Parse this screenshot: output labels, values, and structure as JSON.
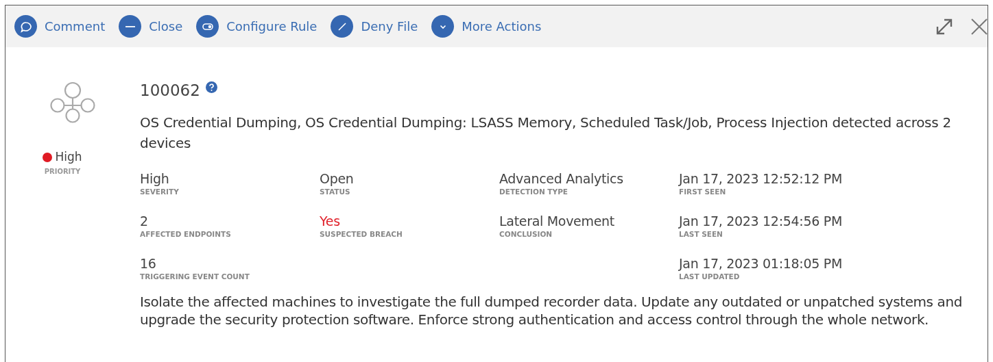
{
  "toolbar": {
    "actions": [
      {
        "label": "Comment",
        "kind": "comment"
      },
      {
        "label": "Close",
        "kind": "close"
      },
      {
        "label": "Configure Rule",
        "kind": "configure"
      },
      {
        "label": "Deny File",
        "kind": "deny"
      },
      {
        "label": "More Actions",
        "kind": "more"
      }
    ]
  },
  "incident": {
    "id": "100062",
    "priority": {
      "value": "High",
      "label": "PRIORITY",
      "color": "#e01b24"
    },
    "description": "OS Credential Dumping, OS Credential Dumping: LSASS Memory, Scheduled Task/Job, Process Injection detected across 2 devices",
    "columns": [
      [
        {
          "value": "High",
          "label": "SEVERITY",
          "alert": false
        },
        {
          "value": "2",
          "label": "AFFECTED ENDPOINTS",
          "alert": false
        },
        {
          "value": "16",
          "label": "TRIGGERING EVENT COUNT",
          "alert": false
        }
      ],
      [
        {
          "value": "Open",
          "label": "STATUS",
          "alert": false
        },
        {
          "value": "Yes",
          "label": "SUSPECTED BREACH",
          "alert": true
        }
      ],
      [
        {
          "value": "Advanced Analytics",
          "label": "DETECTION TYPE",
          "alert": false
        },
        {
          "value": "Lateral Movement",
          "label": "CONCLUSION",
          "alert": false
        }
      ],
      [
        {
          "value": "Jan 17, 2023 12:52:12 PM",
          "label": "FIRST SEEN",
          "alert": false
        },
        {
          "value": "Jan 17, 2023 12:54:56 PM",
          "label": "LAST SEEN",
          "alert": false
        },
        {
          "value": "Jan 17, 2023 01:18:05 PM",
          "label": "LAST UPDATED",
          "alert": false
        }
      ]
    ],
    "recommendation": "Isolate the affected machines to investigate the full dumped recorder data. Update any outdated or unpatched systems and upgrade the security protection software. Enforce strong authentication and access control through the whole network."
  }
}
